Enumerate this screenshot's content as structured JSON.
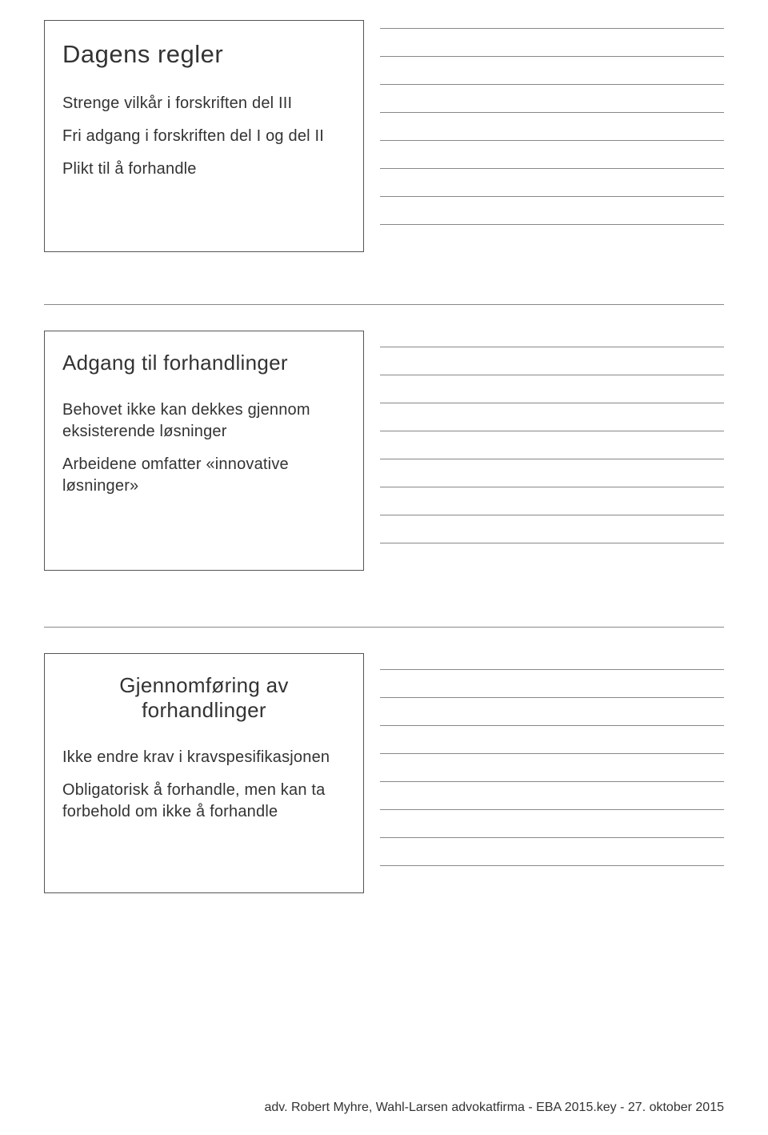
{
  "section1": {
    "title": "Dagens regler",
    "p1": "Strenge vilkår i forskriften del III",
    "p2": "Fri adgang i forskriften del I og del II",
    "p3": "Plikt til å forhandle"
  },
  "section2": {
    "title": "Adgang til forhandlinger",
    "p1": "Behovet ikke kan dekkes gjennom eksisterende løsninger",
    "p2": "Arbeidene omfatter «innovative løsninger»"
  },
  "section3": {
    "title": "Gjennomføring av forhandlinger",
    "p1": "Ikke endre krav i kravspesifikasjonen",
    "p2": "Obligatorisk å forhandle, men kan ta forbehold om ikke å forhandle"
  },
  "footer": "adv. Robert Myhre, Wahl-Larsen advokatfirma - EBA 2015.key - 27. oktober 2015"
}
